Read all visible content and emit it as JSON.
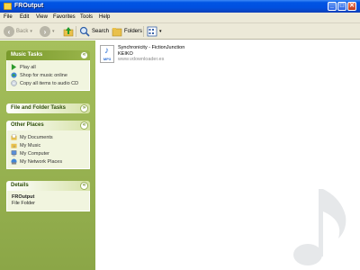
{
  "window": {
    "title": "FROutput"
  },
  "title_buttons": {
    "minimize": "_",
    "maximize": "□",
    "close": "✕"
  },
  "menu": [
    "File",
    "Edit",
    "View",
    "Favorites",
    "Tools",
    "Help"
  ],
  "toolbar": {
    "back": "Back",
    "search": "Search",
    "folders": "Folders"
  },
  "sidebar": {
    "music_tasks": {
      "title": "Music Tasks",
      "items": [
        "Play all",
        "Shop for music online",
        "Copy all items to audio CD"
      ]
    },
    "file_folder_tasks": {
      "title": "File and Folder Tasks"
    },
    "other_places": {
      "title": "Other Places",
      "items": [
        "My Documents",
        "My Music",
        "My Computer",
        "My Network Places"
      ]
    },
    "details": {
      "title": "Details",
      "name": "FROutput",
      "type": "File Folder"
    }
  },
  "files": [
    {
      "name": "Synchronicity - FictionJunction",
      "artist": "KEIKO",
      "source": "www.vdownloader.es",
      "icon": "mp3-file-icon",
      "ext": "MP3"
    }
  ],
  "colors": {
    "title_bar": "#0054e3",
    "sidebar": "#9bb554",
    "chrome": "#ece9d8"
  }
}
